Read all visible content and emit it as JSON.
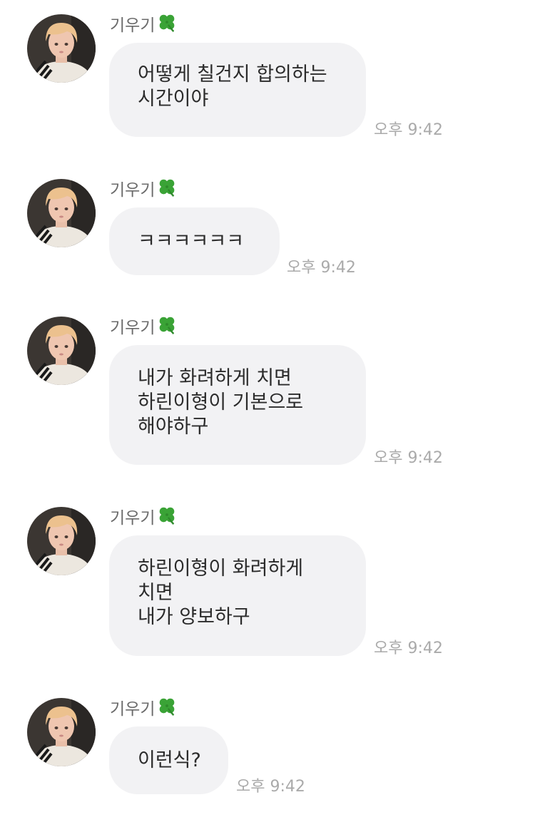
{
  "sender_name": "기우기",
  "messages": [
    {
      "lines": [
        "어떻게 칠건지 합의하는",
        "시간이야"
      ],
      "time": "오후 9:42"
    },
    {
      "lines": [
        "ㅋㅋㅋㅋㅋㅋ"
      ],
      "time": "오후 9:42"
    },
    {
      "lines": [
        "내가 화려하게 치면",
        "하린이형이 기본으로",
        "해야하구"
      ],
      "time": "오후 9:42"
    },
    {
      "lines": [
        "하린이형이 화려하게",
        "치면",
        "내가 양보하구"
      ],
      "time": "오후 9:42"
    },
    {
      "lines": [
        "이런식?"
      ],
      "time": "오후 9:42"
    }
  ],
  "colors": {
    "bubble": "#f2f2f4",
    "text": "#2b2b2b",
    "sender": "#6b6b6b",
    "time": "#aaaaaa",
    "clover": "#3aa336"
  },
  "icons": {
    "sender_badge": "four-leaf-clover-icon"
  }
}
